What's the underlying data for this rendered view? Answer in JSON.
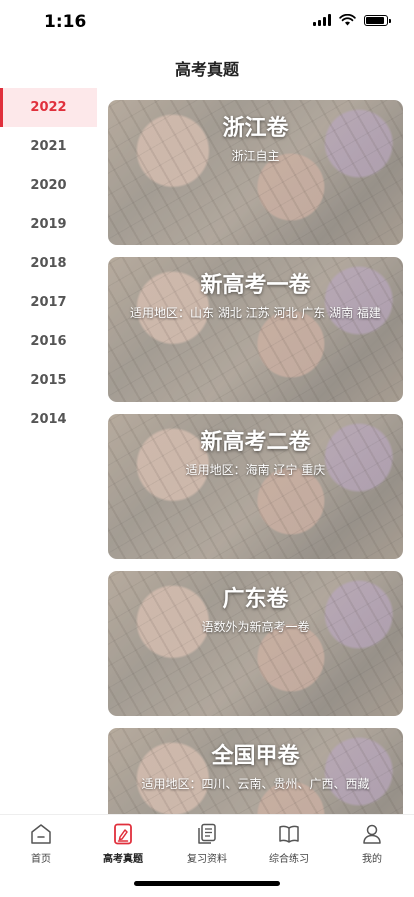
{
  "status_bar": {
    "time": "1:16"
  },
  "header": {
    "title": "高考真题"
  },
  "sidebar": {
    "years": [
      {
        "label": "2022",
        "active": true
      },
      {
        "label": "2021",
        "active": false
      },
      {
        "label": "2020",
        "active": false
      },
      {
        "label": "2019",
        "active": false
      },
      {
        "label": "2018",
        "active": false
      },
      {
        "label": "2017",
        "active": false
      },
      {
        "label": "2016",
        "active": false
      },
      {
        "label": "2015",
        "active": false
      },
      {
        "label": "2014",
        "active": false
      }
    ]
  },
  "cards": [
    {
      "title": "浙江卷",
      "subtitle": "浙江自主"
    },
    {
      "title": "新高考一卷",
      "subtitle": "适用地区：山东 湖北 江苏 河北 广东 湖南 福建"
    },
    {
      "title": "新高考二卷",
      "subtitle": "适用地区：海南 辽宁 重庆"
    },
    {
      "title": "广东卷",
      "subtitle": "语数外为新高考一卷"
    },
    {
      "title": "全国甲卷",
      "subtitle": "适用地区：四川、云南、贵州、广西、西藏"
    }
  ],
  "tabbar": {
    "tabs": [
      {
        "label": "首页",
        "icon": "home-icon"
      },
      {
        "label": "高考真题",
        "icon": "exam-paper-icon",
        "active": true
      },
      {
        "label": "复习资料",
        "icon": "document-icon"
      },
      {
        "label": "综合练习",
        "icon": "book-icon"
      },
      {
        "label": "我的",
        "icon": "profile-icon"
      }
    ]
  },
  "colors": {
    "accent": "#e0303c",
    "active_bg": "#fde8ea"
  }
}
